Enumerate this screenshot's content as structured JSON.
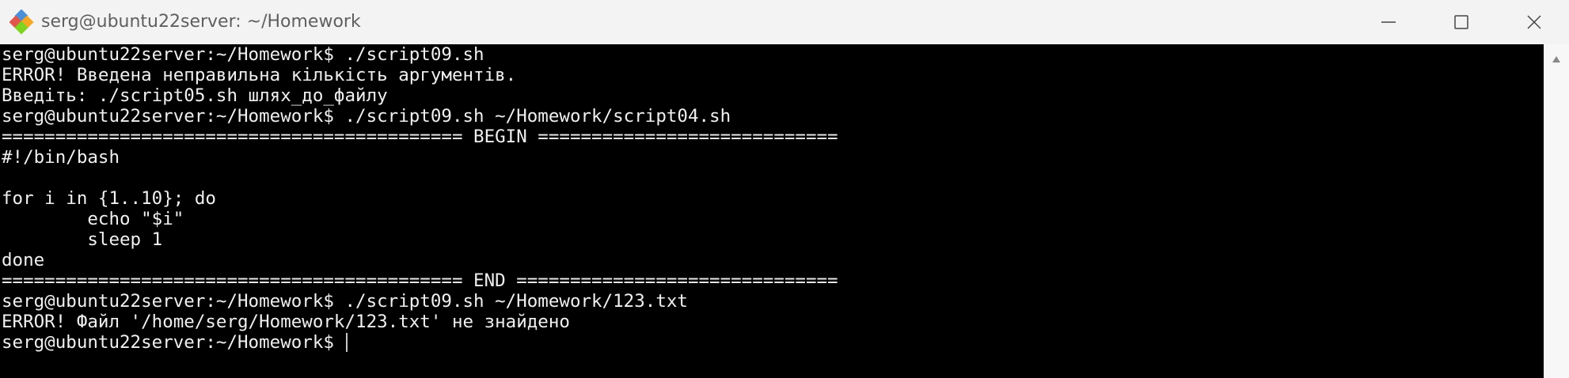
{
  "window": {
    "title": "serg@ubuntu22server: ~/Homework"
  },
  "icons": {
    "app": "putty-icon",
    "minimize": "minimize-icon",
    "maximize": "maximize-icon",
    "close": "close-icon",
    "scroll_up": "scroll-up-arrow-icon"
  },
  "colors": {
    "titlebar_bg": "#f3f3f3",
    "title_text": "#5f5f5f",
    "terminal_bg": "#000000",
    "terminal_fg": "#f0f0f0"
  },
  "terminal": {
    "lines": [
      "serg@ubuntu22server:~/Homework$ ./script09.sh",
      "ERROR! Введена неправильна кількість аргументів.",
      "Введіть: ./script05.sh шлях_до_файлу",
      "serg@ubuntu22server:~/Homework$ ./script09.sh ~/Homework/script04.sh",
      "=========================================== BEGIN ============================",
      "#!/bin/bash",
      "",
      "for i in {1..10}; do",
      "        echo \"$i\"",
      "        sleep 1",
      "done",
      "=========================================== END ==============================",
      "serg@ubuntu22server:~/Homework$ ./script09.sh ~/Homework/123.txt",
      "ERROR! Файл '/home/serg/Homework/123.txt' не знайдено",
      "serg@ubuntu22server:~/Homework$ "
    ]
  }
}
